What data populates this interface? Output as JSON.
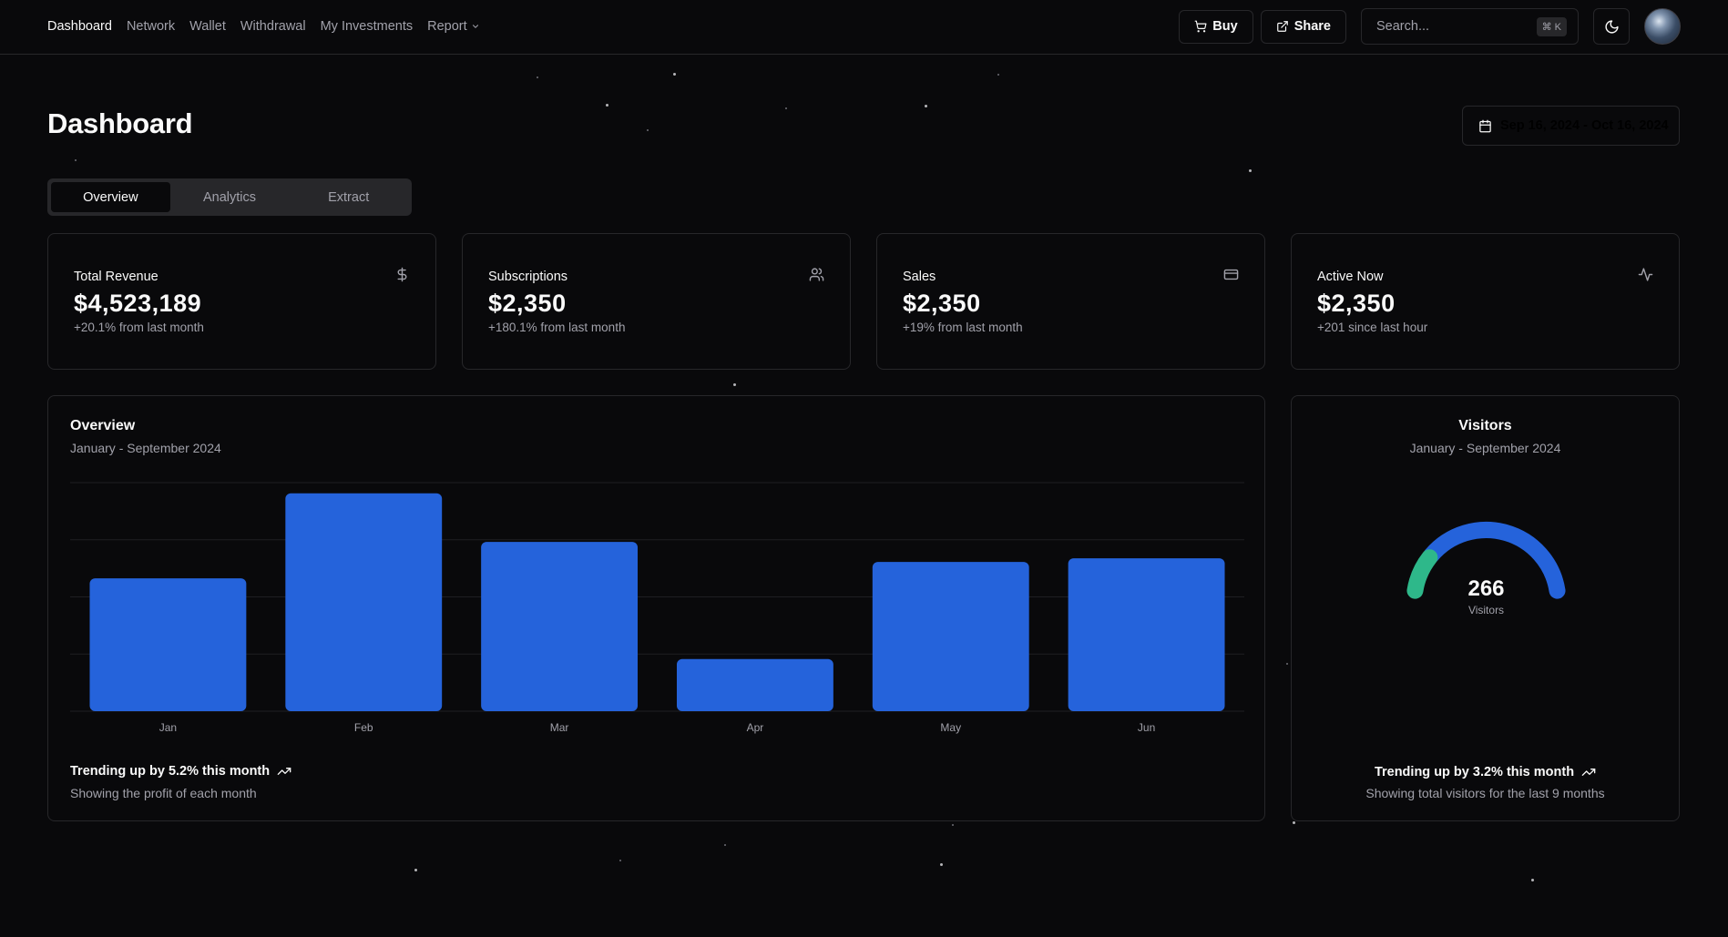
{
  "nav": {
    "items": [
      {
        "label": "Dashboard",
        "active": true
      },
      {
        "label": "Network",
        "active": false
      },
      {
        "label": "Wallet",
        "active": false
      },
      {
        "label": "Withdrawal",
        "active": false
      },
      {
        "label": "My Investments",
        "active": false
      },
      {
        "label": "Report",
        "active": false,
        "dropdown": true
      }
    ]
  },
  "toolbar": {
    "buy_label": "Buy",
    "buy_icon": "cart-icon",
    "share_label": "Share",
    "share_icon": "share-icon",
    "search_placeholder": "Search...",
    "search_shortcut": "⌘ K",
    "theme_icon": "moon-icon"
  },
  "page": {
    "title": "Dashboard",
    "date_range": "Sep 16, 2024 - Oct 16, 2024",
    "tabs": [
      {
        "label": "Overview",
        "active": true
      },
      {
        "label": "Analytics",
        "active": false
      },
      {
        "label": "Extract",
        "active": false
      }
    ]
  },
  "stats": [
    {
      "label": "Total Revenue",
      "value": "$4,523,189",
      "sub": "+20.1% from last month",
      "icon": "dollar-icon"
    },
    {
      "label": "Subscriptions",
      "value": "$2,350",
      "sub": "+180.1% from last month",
      "icon": "users-icon"
    },
    {
      "label": "Sales",
      "value": "$2,350",
      "sub": "+19% from last month",
      "icon": "credit-card-icon"
    },
    {
      "label": "Active Now",
      "value": "$2,350",
      "sub": "+201 since last hour",
      "icon": "activity-icon"
    }
  ],
  "overview": {
    "title": "Overview",
    "subtitle": "January - September 2024",
    "trend": "Trending up by 5.2% this month",
    "note": "Showing the profit of each month"
  },
  "visitors": {
    "title": "Visitors",
    "subtitle": "January - September 2024",
    "value": "266",
    "value_label": "Visitors",
    "trend": "Trending up by 3.2% this month",
    "note": "Showing total visitors for the last 9 months",
    "colors": {
      "primary": "#2563db",
      "secondary": "#2eb88a"
    }
  },
  "colors": {
    "accent": "#2563db",
    "background": "#09090b",
    "border": "#27272a",
    "muted": "#a1a1aa"
  },
  "chart_data": [
    {
      "type": "bar",
      "categories": [
        "Jan",
        "Feb",
        "Mar",
        "Apr",
        "May",
        "Jun"
      ],
      "values": [
        186,
        305,
        237,
        73,
        209,
        214
      ],
      "ylim": [
        0,
        320
      ],
      "grid": true,
      "color": "#2563db"
    },
    {
      "type": "pie",
      "title": "Visitors",
      "subtitle": "January - September 2024",
      "series": [
        {
          "value": 0.18,
          "color": "#2eb88a"
        },
        {
          "value": 0.82,
          "color": "#2563db"
        }
      ],
      "total": 266
    }
  ]
}
